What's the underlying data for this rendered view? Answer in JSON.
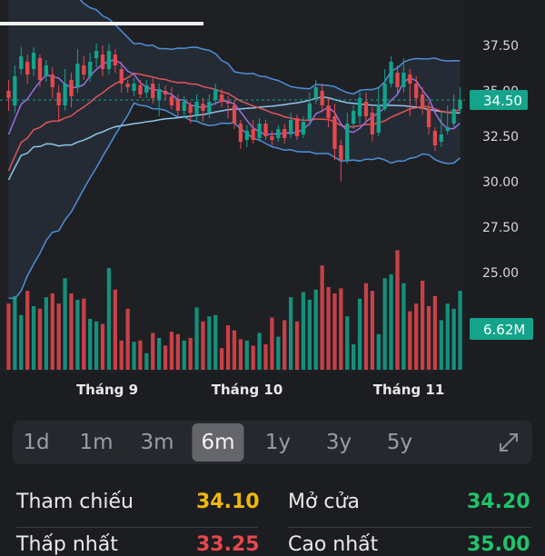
{
  "colors": {
    "up": "#14a38b",
    "down": "#e5484d",
    "background": "#1c1d20",
    "reference": "#f0b90b",
    "price_tag": "#14a38b"
  },
  "chart": {
    "current_price": "34.50",
    "volume_label": "6.62M",
    "y_ticks": [
      "37.50",
      "35.00",
      "32.50",
      "30.00",
      "27.50",
      "25.00"
    ],
    "x_labels": [
      "Tháng 9",
      "Tháng 10",
      "Tháng 11"
    ]
  },
  "periods": [
    {
      "label": "1d"
    },
    {
      "label": "1m"
    },
    {
      "label": "3m"
    },
    {
      "label": "6m",
      "active": true
    },
    {
      "label": "1y"
    },
    {
      "label": "3y"
    },
    {
      "label": "5y"
    }
  ],
  "stats": {
    "reference_label": "Tham chiếu",
    "reference_value": "34.10",
    "open_label": "Mở cửa",
    "open_value": "34.20",
    "ceiling_label": "Thấp nhất",
    "ceiling_value": "33.25",
    "high_label": "Cao nhất",
    "high_value": "35.00"
  },
  "chart_data": {
    "type": "candlestick",
    "y_range": [
      23.5,
      38.5
    ],
    "candles": [
      [
        35.0,
        34.6,
        35.6,
        33.9
      ],
      [
        34.2,
        35.8,
        36.4,
        33.8
      ],
      [
        36.2,
        36.9,
        37.4,
        35.9
      ],
      [
        36.6,
        35.9,
        37.0,
        35.4
      ],
      [
        36.2,
        37.1,
        37.4,
        35.8
      ],
      [
        36.8,
        35.6,
        37.0,
        35.2
      ],
      [
        35.8,
        36.4,
        36.7,
        35.5
      ],
      [
        35.9,
        35.2,
        36.3,
        34.6
      ],
      [
        34.9,
        34.2,
        35.3,
        33.3
      ],
      [
        34.2,
        35.4,
        36.2,
        33.9
      ],
      [
        35.6,
        34.7,
        36.0,
        34.1
      ],
      [
        35.2,
        36.5,
        37.3,
        34.9
      ],
      [
        36.4,
        35.9,
        36.9,
        35.6
      ],
      [
        35.8,
        36.6,
        37.1,
        35.5
      ],
      [
        36.8,
        37.2,
        37.6,
        36.3
      ],
      [
        37.0,
        36.2,
        37.5,
        35.8
      ],
      [
        36.2,
        37.2,
        37.6,
        35.9
      ],
      [
        37.0,
        36.4,
        37.3,
        36.0
      ],
      [
        36.2,
        35.4,
        36.6,
        34.9
      ],
      [
        35.4,
        35.2,
        35.6,
        34.9
      ],
      [
        35.0,
        35.4,
        35.7,
        34.7
      ],
      [
        35.3,
        34.8,
        35.6,
        34.6
      ],
      [
        34.9,
        35.3,
        35.6,
        34.6
      ],
      [
        35.4,
        34.6,
        35.7,
        34.3
      ],
      [
        34.5,
        35.1,
        35.4,
        33.6
      ],
      [
        35.0,
        34.8,
        35.3,
        34.5
      ],
      [
        34.7,
        34.2,
        35.2,
        34.0
      ],
      [
        34.5,
        33.9,
        34.8,
        33.6
      ],
      [
        33.9,
        34.4,
        34.7,
        33.5
      ],
      [
        34.2,
        33.8,
        34.4,
        33.2
      ],
      [
        33.7,
        34.4,
        34.8,
        33.4
      ],
      [
        34.3,
        33.9,
        34.6,
        33.3
      ],
      [
        33.8,
        34.4,
        34.8,
        33.5
      ],
      [
        34.5,
        35.1,
        35.4,
        34.2
      ],
      [
        34.8,
        34.4,
        35.1,
        34.1
      ],
      [
        34.4,
        34.3,
        34.7,
        33.5
      ],
      [
        34.2,
        33.2,
        34.5,
        32.9
      ],
      [
        33.2,
        32.2,
        33.4,
        31.8
      ],
      [
        32.3,
        32.8,
        33.1,
        31.9
      ],
      [
        32.9,
        32.3,
        33.4,
        32.1
      ],
      [
        32.4,
        33.2,
        33.5,
        32.2
      ],
      [
        33.2,
        32.5,
        33.4,
        32.3
      ],
      [
        32.5,
        32.3,
        32.8,
        32.0
      ],
      [
        32.4,
        32.9,
        33.1,
        32.2
      ],
      [
        32.9,
        32.4,
        33.2,
        32.1
      ],
      [
        32.6,
        33.4,
        33.8,
        32.4
      ],
      [
        33.5,
        32.5,
        33.7,
        32.3
      ],
      [
        32.6,
        33.3,
        33.6,
        32.4
      ],
      [
        33.4,
        34.3,
        34.9,
        33.1
      ],
      [
        34.6,
        35.2,
        35.6,
        34.3
      ],
      [
        35.0,
        34.2,
        35.4,
        33.8
      ],
      [
        34.2,
        33.5,
        34.6,
        33.0
      ],
      [
        33.6,
        31.8,
        34.3,
        31.2
      ],
      [
        32.0,
        31.2,
        32.3,
        30.0
      ],
      [
        31.2,
        33.2,
        33.8,
        31.0
      ],
      [
        33.2,
        33.9,
        34.2,
        32.9
      ],
      [
        33.6,
        34.6,
        35.0,
        33.2
      ],
      [
        34.4,
        33.6,
        34.9,
        33.3
      ],
      [
        33.8,
        32.6,
        34.1,
        32.2
      ],
      [
        32.7,
        34.2,
        35.2,
        32.5
      ],
      [
        34.0,
        35.4,
        36.2,
        33.9
      ],
      [
        35.4,
        36.6,
        36.9,
        35.2
      ],
      [
        36.0,
        35.2,
        36.4,
        34.8
      ],
      [
        35.2,
        36.0,
        36.8,
        34.9
      ],
      [
        35.9,
        35.4,
        36.2,
        33.6
      ],
      [
        35.4,
        34.6,
        35.8,
        34.2
      ],
      [
        34.8,
        34.0,
        35.2,
        33.7
      ],
      [
        34.0,
        33.0,
        34.4,
        32.6
      ],
      [
        32.8,
        32.0,
        33.0,
        31.7
      ],
      [
        32.2,
        32.6,
        33.8,
        31.9
      ],
      [
        32.8,
        33.0,
        34.2,
        32.6
      ],
      [
        33.2,
        34.0,
        34.8,
        33.0
      ],
      [
        34.0,
        34.5,
        35.2,
        33.8
      ]
    ],
    "volumes": [
      0.52,
      0.58,
      0.43,
      0.62,
      0.5,
      0.48,
      0.57,
      0.6,
      0.52,
      0.72,
      0.6,
      0.55,
      0.56,
      0.4,
      0.38,
      0.36,
      0.8,
      0.63,
      0.23,
      0.48,
      0.22,
      0.23,
      0.13,
      0.29,
      0.25,
      0.19,
      0.3,
      0.28,
      0.23,
      0.25,
      0.49,
      0.38,
      0.42,
      0.43,
      0.17,
      0.35,
      0.31,
      0.24,
      0.23,
      0.19,
      0.29,
      0.2,
      0.41,
      0.26,
      0.39,
      0.57,
      0.38,
      0.61,
      0.55,
      0.63,
      0.82,
      0.65,
      0.6,
      0.64,
      0.42,
      0.2,
      0.56,
      0.68,
      0.62,
      0.28,
      0.72,
      0.75,
      0.94,
      0.68,
      0.46,
      0.52,
      0.7,
      0.5,
      0.58,
      0.39,
      0.52,
      0.48,
      0.62
    ],
    "volume_y_label": "6.62M"
  }
}
